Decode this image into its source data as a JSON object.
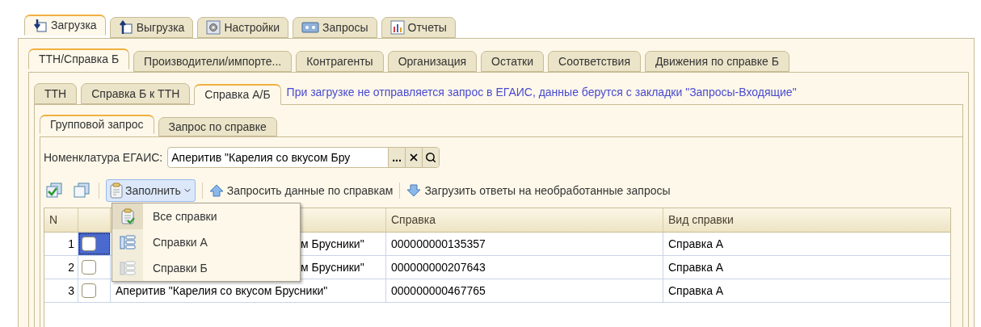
{
  "main_tabs": [
    {
      "label": "Загрузка",
      "selected": true
    },
    {
      "label": "Выгрузка",
      "selected": false
    },
    {
      "label": "Настройки",
      "selected": false
    },
    {
      "label": "Запросы",
      "selected": false
    },
    {
      "label": "Отчеты",
      "selected": false
    }
  ],
  "sub_tabs": [
    {
      "label": "ТТН/Справка Б",
      "selected": true
    },
    {
      "label": "Производители/импорте...",
      "selected": false
    },
    {
      "label": "Контрагенты",
      "selected": false
    },
    {
      "label": "Организация",
      "selected": false
    },
    {
      "label": "Остатки",
      "selected": false
    },
    {
      "label": "Соответствия",
      "selected": false
    },
    {
      "label": "Движения по справке Б",
      "selected": false
    }
  ],
  "doc_tabs": [
    {
      "label": "ТТН",
      "selected": false
    },
    {
      "label": "Справка Б к ТТН",
      "selected": false
    },
    {
      "label": "Справка А/Б",
      "selected": true
    }
  ],
  "info_text": "При загрузке не отправляется запрос в ЕГАИС, данные берутся с закладки \"Запросы-Входящие\"",
  "request_tabs": [
    {
      "label": "Групповой запрос",
      "selected": true
    },
    {
      "label": "Запрос по справке",
      "selected": false
    }
  ],
  "nomenclature_field": {
    "label": "Номенклатура ЕГАИС:",
    "value": "Аперитив \"Карелия со вкусом Бру",
    "choose_button": "..."
  },
  "toolbar": {
    "fill_button": {
      "label": "Заполнить",
      "open": true
    },
    "request_button": "Запросить данные по справкам",
    "load_button": "Загрузить ответы на необработанные запросы"
  },
  "fill_menu": [
    {
      "label": "Все справки",
      "selected": true
    },
    {
      "label": "Справки А",
      "selected": false
    },
    {
      "label": "Справки Б",
      "selected": false
    }
  ],
  "table": {
    "columns": [
      "N",
      "Справка",
      "Вид справки"
    ],
    "rows": [
      {
        "n": "1",
        "checked": false,
        "selected": true,
        "name": "м Брусники\"",
        "name_covered": true,
        "certificate": "000000000135357",
        "type": "Справка А"
      },
      {
        "n": "2",
        "checked": false,
        "selected": false,
        "name": "м Брусники\"",
        "name_covered": true,
        "certificate": "000000000207643",
        "type": "Справка А"
      },
      {
        "n": "3",
        "checked": false,
        "selected": false,
        "name": "Аперитив \"Карелия со вкусом Брусники\"",
        "name_covered": false,
        "certificate": "000000000467765",
        "type": "Справка А"
      }
    ]
  }
}
